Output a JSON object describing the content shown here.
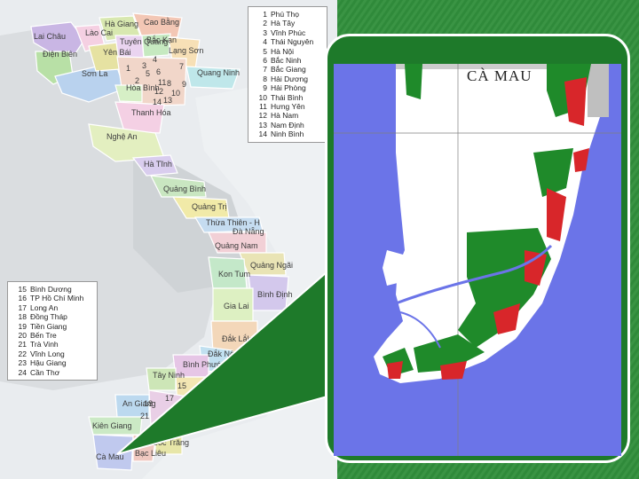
{
  "map": {
    "title": "CÀ MAU",
    "provinces_north": [
      {
        "key": "lai_chau",
        "label": "Lai Châu"
      },
      {
        "key": "lao_cai",
        "label": "Lào Cai"
      },
      {
        "key": "ha_giang",
        "label": "Hà Giang"
      },
      {
        "key": "cao_bang",
        "label": "Cao Bằng"
      },
      {
        "key": "dien_bien",
        "label": "Điện Biên"
      },
      {
        "key": "tuyen_quang",
        "label": "Tuyên Quang"
      },
      {
        "key": "bac_kan",
        "label": "Bắc Kạn"
      },
      {
        "key": "yen_bai",
        "label": "Yên Bái"
      },
      {
        "key": "lang_son",
        "label": "Lạng Sơn"
      },
      {
        "key": "son_la",
        "label": "Sơn La"
      },
      {
        "key": "quang_ninh",
        "label": "Quang Ninh"
      },
      {
        "key": "hoa_binh",
        "label": "Hòa Bình"
      },
      {
        "key": "thanh_hoa",
        "label": "Thanh Hóa"
      },
      {
        "key": "nghe_an",
        "label": "Nghệ An"
      },
      {
        "key": "ha_tinh",
        "label": "Hà Tĩnh"
      },
      {
        "key": "quang_binh",
        "label": "Quảng Bình"
      },
      {
        "key": "quang_tri",
        "label": "Quảng Trị"
      },
      {
        "key": "thua_thien",
        "label": "Thừa Thiên - H"
      },
      {
        "key": "da_nang",
        "label": "Đà Nẵng"
      },
      {
        "key": "quang_nam",
        "label": "Quảng Nam"
      },
      {
        "key": "quang_ngai",
        "label": "Quảng Ngãi"
      },
      {
        "key": "kon_tum",
        "label": "Kon Tum"
      },
      {
        "key": "binh_dinh",
        "label": "Bình Định"
      },
      {
        "key": "gia_lai",
        "label": "Gia Lai"
      },
      {
        "key": "dak_lak",
        "label": "Đắk Lắk"
      },
      {
        "key": "dak_nong",
        "label": "Đắk Nông"
      },
      {
        "key": "binh_phuoc",
        "label": "Bình Phước"
      },
      {
        "key": "tay_ninh",
        "label": "Tây Ninh"
      },
      {
        "key": "an_giang",
        "label": "An Giang"
      },
      {
        "key": "kien_giang",
        "label": "Kiên Giang"
      },
      {
        "key": "ca_mau",
        "label": "Cà Mau"
      },
      {
        "key": "bac_lieu",
        "label": "Bạc Liêu"
      },
      {
        "key": "soc_trang",
        "label": "Sóc Trăng"
      }
    ],
    "map_numbers": [
      "1",
      "2",
      "3",
      "4",
      "5",
      "6",
      "7",
      "8",
      "9",
      "10",
      "11",
      "12",
      "13",
      "14",
      "15",
      "17",
      "18",
      "21",
      "24"
    ],
    "legend_north": [
      {
        "n": "1",
        "name": "Phú Thọ"
      },
      {
        "n": "2",
        "name": "Hà Tây"
      },
      {
        "n": "3",
        "name": "Vĩnh Phúc"
      },
      {
        "n": "4",
        "name": "Thái Nguyên"
      },
      {
        "n": "5",
        "name": "Hà Nội"
      },
      {
        "n": "6",
        "name": "Bắc Ninh"
      },
      {
        "n": "7",
        "name": "Bắc Giang"
      },
      {
        "n": "8",
        "name": "Hải Dương"
      },
      {
        "n": "9",
        "name": "Hải Phòng"
      },
      {
        "n": "10",
        "name": "Thái Bình"
      },
      {
        "n": "11",
        "name": "Hưng Yên"
      },
      {
        "n": "12",
        "name": "Hà Nam"
      },
      {
        "n": "13",
        "name": "Nam Định"
      },
      {
        "n": "14",
        "name": "Ninh Bình"
      }
    ],
    "legend_south": [
      {
        "n": "15",
        "name": "Bình Dương"
      },
      {
        "n": "16",
        "name": "TP Hồ Chí Minh"
      },
      {
        "n": "17",
        "name": "Long An"
      },
      {
        "n": "18",
        "name": "Đồng Tháp"
      },
      {
        "n": "19",
        "name": "Tiền Giang"
      },
      {
        "n": "20",
        "name": "Bến Tre"
      },
      {
        "n": "21",
        "name": "Trà Vinh"
      },
      {
        "n": "22",
        "name": "Vĩnh Long"
      },
      {
        "n": "23",
        "name": "Hậu Giang"
      },
      {
        "n": "24",
        "name": "Cần Thơ"
      }
    ],
    "colors": {
      "sea": "#6b74e8",
      "frame": "#1e7a2a",
      "background": "#2f8a3a",
      "forest_green": "#1f8a2a",
      "mangrove_red": "#d8262a"
    }
  }
}
